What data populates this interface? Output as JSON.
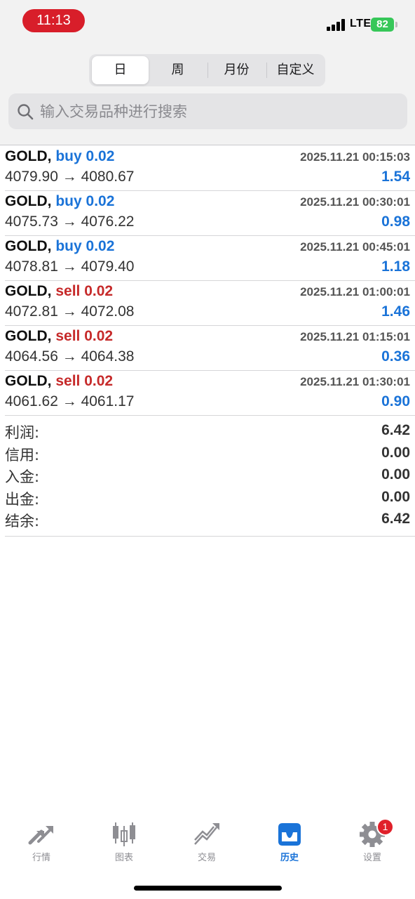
{
  "status_bar": {
    "time": "11:13",
    "network": "LTE",
    "battery": "82"
  },
  "period_tabs": [
    {
      "label": "日",
      "active": true
    },
    {
      "label": "周",
      "active": false
    },
    {
      "label": "月份",
      "active": false
    },
    {
      "label": "自定义",
      "active": false
    }
  ],
  "search": {
    "placeholder": "输入交易品种进行搜索"
  },
  "trades": [
    {
      "symbol": "GOLD,",
      "side": "buy 0.02",
      "time": "2025.11.21 00:15:03",
      "prices": "4079.90 → 4080.67",
      "profit": "1.54"
    },
    {
      "symbol": "GOLD,",
      "side": "buy 0.02",
      "time": "2025.11.21 00:30:01",
      "prices": "4075.73 → 4076.22",
      "profit": "0.98"
    },
    {
      "symbol": "GOLD,",
      "side": "buy 0.02",
      "time": "2025.11.21 00:45:01",
      "prices": "4078.81 → 4079.40",
      "profit": "1.18"
    },
    {
      "symbol": "GOLD,",
      "side": "sell 0.02",
      "time": "2025.11.21 01:00:01",
      "prices": "4072.81 → 4072.08",
      "profit": "1.46"
    },
    {
      "symbol": "GOLD,",
      "side": "sell 0.02",
      "time": "2025.11.21 01:15:01",
      "prices": "4064.56 → 4064.38",
      "profit": "0.36"
    },
    {
      "symbol": "GOLD,",
      "side": "sell 0.02",
      "time": "2025.11.21 01:30:01",
      "prices": "4061.62 → 4061.17",
      "profit": "0.90"
    }
  ],
  "summary": {
    "profit_label": "利润:",
    "profit_value": "6.42",
    "credit_label": "信用:",
    "credit_value": "0.00",
    "deposit_label": "入金:",
    "deposit_value": "0.00",
    "withdrawal_label": "出金:",
    "withdrawal_value": "0.00",
    "balance_label": "结余:",
    "balance_value": "6.42"
  },
  "tabbar": {
    "quotes": "行情",
    "chart": "图表",
    "trade": "交易",
    "history": "历史",
    "settings": "设置",
    "settings_badge": "1",
    "active": "history"
  },
  "colors": {
    "accent_blue": "#1a73d8",
    "sell_red": "#c62a2a",
    "time_pill_red": "#d81e2a",
    "battery_green": "#37c759"
  }
}
